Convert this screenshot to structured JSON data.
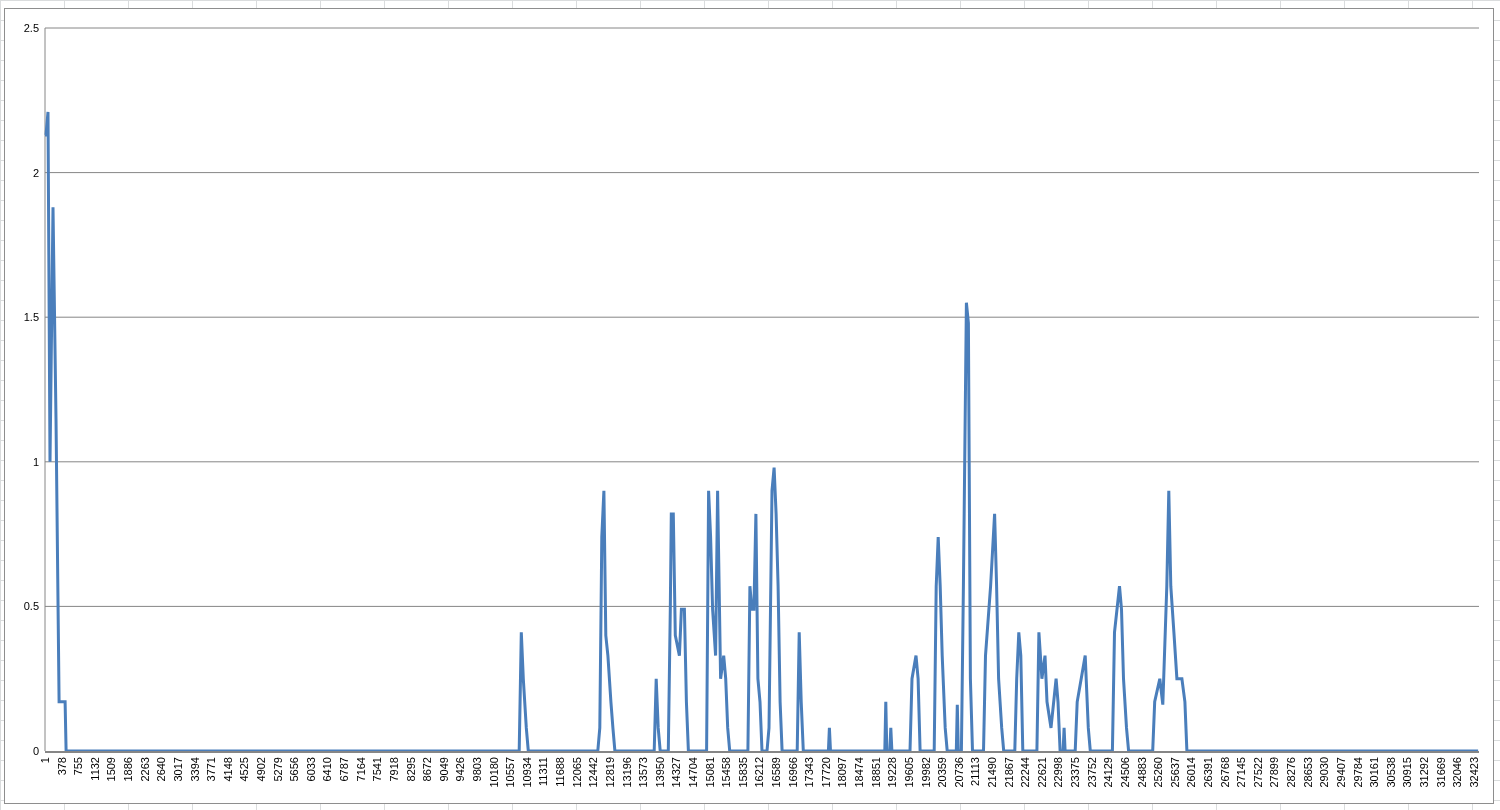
{
  "chart": {
    "chart_data": {
      "type": "line",
      "grid": true,
      "xlim": [
        1,
        32540
      ],
      "ylim": [
        0,
        2.5
      ],
      "yticks": [
        0,
        0.5,
        1,
        1.5,
        2,
        2.5
      ],
      "xticks": [
        1,
        378,
        755,
        1132,
        1509,
        1886,
        2263,
        2640,
        3017,
        3394,
        3771,
        4148,
        4525,
        4902,
        5279,
        5656,
        6033,
        6410,
        6787,
        7164,
        7541,
        7918,
        8295,
        8672,
        9049,
        9426,
        9803,
        10180,
        10557,
        10934,
        11311,
        11688,
        12065,
        12442,
        12819,
        13196,
        13573,
        13950,
        14327,
        14704,
        15081,
        15458,
        15835,
        16212,
        16589,
        16966,
        17343,
        17720,
        18097,
        18474,
        18851,
        19228,
        19605,
        19982,
        20359,
        20736,
        21113,
        21490,
        21867,
        22244,
        22621,
        22998,
        23375,
        23752,
        24129,
        24506,
        24883,
        25260,
        25637,
        26014,
        26391,
        26768,
        27145,
        27522,
        27899,
        28276,
        28653,
        29030,
        29407,
        29784,
        30161,
        30538,
        30915,
        31292,
        31669,
        32046,
        32423
      ],
      "x": [
        1,
        23,
        69,
        114,
        183,
        251,
        320,
        457,
        480,
        10762,
        10808,
        10854,
        10922,
        10968,
        12545,
        12590,
        12636,
        12682,
        12727,
        12773,
        12842,
        12887,
        12933,
        13824,
        13870,
        13915,
        13961,
        14144,
        14190,
        14213,
        14258,
        14304,
        14396,
        14441,
        14510,
        14556,
        14601,
        15013,
        15058,
        15104,
        15150,
        15218,
        15264,
        15332,
        15401,
        15447,
        15493,
        15538,
        15950,
        15995,
        16041,
        16087,
        16132,
        16178,
        16224,
        16270,
        16384,
        16430,
        16498,
        16544,
        16590,
        16635,
        16681,
        16727,
        17070,
        17115,
        17161,
        17207,
        17778,
        17801,
        17824,
        19057,
        19080,
        19103,
        19171,
        19194,
        19217,
        19629,
        19675,
        19766,
        19812,
        19857,
        20177,
        20223,
        20268,
        20314,
        20360,
        20428,
        20474,
        20680,
        20703,
        20725,
        20794,
        20840,
        20908,
        20954,
        21000,
        21046,
        21297,
        21343,
        21457,
        21549,
        21594,
        21640,
        21709,
        21754,
        22006,
        22051,
        22097,
        22143,
        22188,
        22508,
        22554,
        22622,
        22691,
        22737,
        22828,
        22943,
        22988,
        23034,
        23103,
        23126,
        23148,
        23377,
        23423,
        23514,
        23605,
        23674,
        23720,
        24222,
        24268,
        24382,
        24428,
        24473,
        24542,
        24588,
        25136,
        25181,
        25296,
        25364,
        25456,
        25501,
        25547,
        25616,
        25684,
        25798,
        25867,
        25913,
        32520
      ],
      "series": [
        {
          "color": "#4a7ebb",
          "values": [
            2.13,
            2.13,
            2.21,
            1.0,
            1.88,
            1.15,
            0.17,
            0.17,
            0,
            0,
            0.41,
            0.25,
            0.08,
            0,
            0,
            0.08,
            0.74,
            0.9,
            0.4,
            0.33,
            0.17,
            0.08,
            0,
            0,
            0.25,
            0.08,
            0,
            0,
            0.49,
            0.82,
            0.82,
            0.4,
            0.33,
            0.49,
            0.49,
            0.17,
            0,
            0,
            0.9,
            0.74,
            0.49,
            0.33,
            0.9,
            0.25,
            0.33,
            0.25,
            0.08,
            0,
            0,
            0.57,
            0.49,
            0.49,
            0.82,
            0.25,
            0.17,
            0,
            0,
            0.08,
            0.9,
            0.98,
            0.82,
            0.57,
            0.17,
            0,
            0,
            0.41,
            0.17,
            0,
            0,
            0.08,
            0,
            0,
            0.17,
            0,
            0,
            0.08,
            0,
            0,
            0.25,
            0.33,
            0.25,
            0,
            0,
            0.57,
            0.74,
            0.57,
            0.33,
            0.08,
            0,
            0,
            0.16,
            0,
            0,
            0.57,
            1.55,
            1.48,
            0.25,
            0,
            0,
            0.33,
            0.57,
            0.82,
            0.57,
            0.25,
            0.08,
            0,
            0,
            0.25,
            0.41,
            0.33,
            0,
            0,
            0.41,
            0.25,
            0.33,
            0.17,
            0.08,
            0.25,
            0.17,
            0,
            0,
            0.08,
            0,
            0,
            0.17,
            0.25,
            0.33,
            0.08,
            0,
            0,
            0.41,
            0.57,
            0.49,
            0.25,
            0.08,
            0,
            0,
            0.17,
            0.25,
            0.16,
            0.57,
            0.9,
            0.57,
            0.41,
            0.25,
            0.25,
            0.17,
            0,
            0
          ]
        }
      ]
    }
  }
}
